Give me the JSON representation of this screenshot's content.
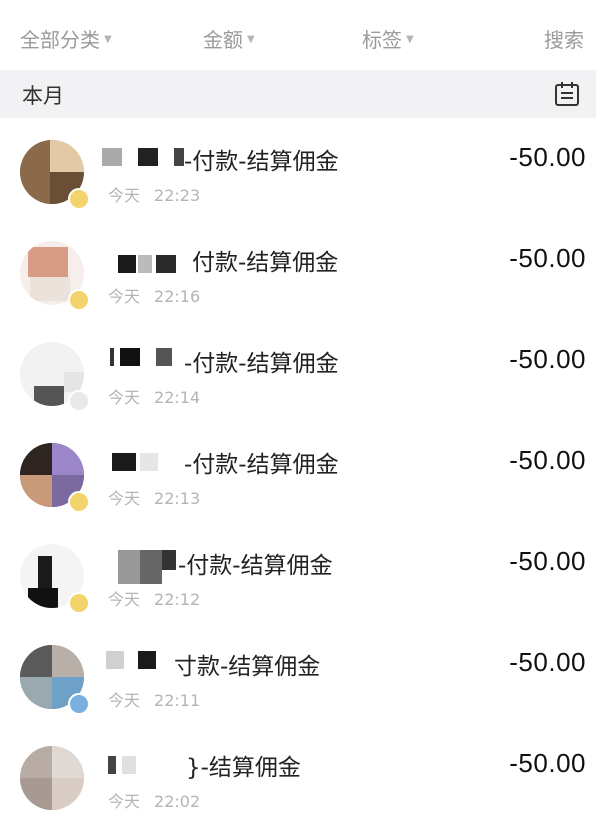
{
  "filters": {
    "category": "全部分类",
    "amount": "金额",
    "tag": "标签",
    "search": "搜索"
  },
  "month": {
    "label": "本月",
    "icon": "calendar-icon"
  },
  "transactions": [
    {
      "title": "付款-结算佣金",
      "title_visible": "-付款-结算佣金",
      "day": "今天",
      "time": "22:23",
      "amount": "-50.00"
    },
    {
      "title": "付款-结算佣金",
      "title_visible": "付款-结算佣金",
      "day": "今天",
      "time": "22:16",
      "amount": "-50.00"
    },
    {
      "title": "付款-结算佣金",
      "title_visible": "-付款-结算佣金",
      "day": "今天",
      "time": "22:14",
      "amount": "-50.00"
    },
    {
      "title": "付款-结算佣金",
      "title_visible": "-付款-结算佣金",
      "day": "今天",
      "time": "22:13",
      "amount": "-50.00"
    },
    {
      "title": "付款-结算佣金",
      "title_visible": "-付款-结算佣金",
      "day": "今天",
      "time": "22:12",
      "amount": "-50.00"
    },
    {
      "title": "付款-结算佣金",
      "title_visible": "寸款-结算佣金",
      "day": "今天",
      "time": "22:11",
      "amount": "-50.00"
    },
    {
      "title": "付款-结算佣金",
      "title_visible": "}-结算佣金",
      "day": "今天",
      "time": "22:02",
      "amount": "-50.00"
    }
  ]
}
